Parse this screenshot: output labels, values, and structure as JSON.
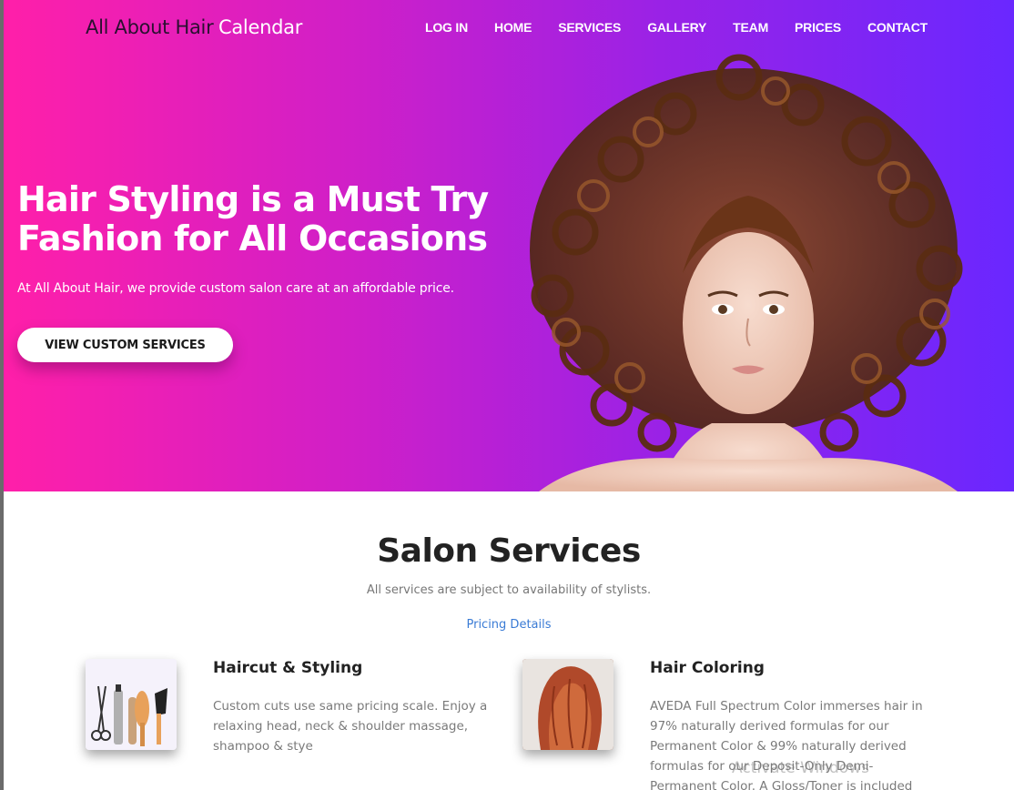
{
  "nav": {
    "brand": "All About Hair",
    "calendar": "Calendar",
    "items": [
      "LOG IN",
      "HOME",
      "SERVICES",
      "GALLERY",
      "TEAM",
      "PRICES",
      "CONTACT"
    ]
  },
  "hero": {
    "title_line1": "Hair Styling is a Must Try",
    "title_line2": "Fashion for All Occasions",
    "subtitle": "At All About Hair, we provide custom salon care at an affordable price.",
    "cta": "VIEW CUSTOM SERVICES",
    "colors": {
      "gradient_start": "#ff1fa9",
      "gradient_end": "#6a27ff"
    }
  },
  "services": {
    "title": "Salon Services",
    "note": "All services are subject to availability of stylists.",
    "pricing_link": "Pricing Details",
    "items": [
      {
        "title": "Haircut & Styling",
        "description": "Custom cuts use same pricing scale. Enjoy a relaxing head, neck & shoulder massage, shampoo & stye",
        "icon": "scissors-tools-image"
      },
      {
        "title": "Hair Coloring",
        "description": "AVEDA Full Spectrum Color immerses hair in 97% naturally derived formulas for our Permanent Color & 99% naturally derived formulas for our Deposit-Only Demi-Permanent Color. A Gloss/Toner is included",
        "icon": "colored-hair-image"
      }
    ]
  },
  "overlay": {
    "watermark": "Activate Windows"
  }
}
